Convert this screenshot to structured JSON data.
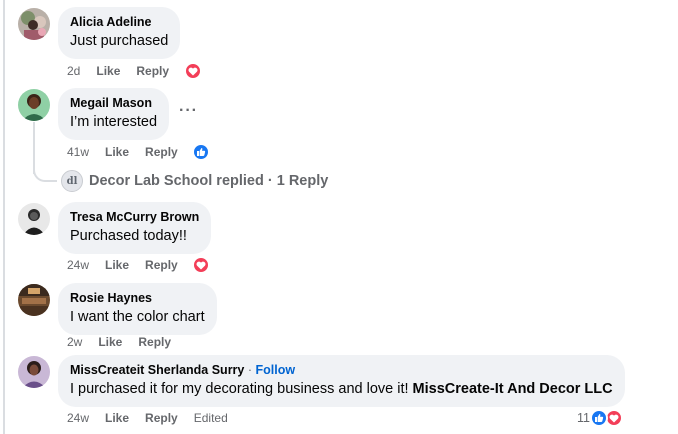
{
  "comments": [
    {
      "author": "Alicia Adeline",
      "text": "Just purchased",
      "time": "2d",
      "like": "Like",
      "reply": "Reply",
      "reaction": "heart"
    },
    {
      "author": "Megail Mason",
      "text": "I’m interested",
      "time": "41w",
      "like": "Like",
      "reply": "Reply",
      "reaction": "like",
      "more": "···",
      "replies_summary": {
        "author": "Decor Lab School",
        "label": "Decor Lab School replied · 1 Reply"
      }
    },
    {
      "author": "Tresa McCurry Brown",
      "text": "Purchased today!!",
      "time": "24w",
      "like": "Like",
      "reply": "Reply",
      "reaction": "heart"
    },
    {
      "author": "Rosie Haynes",
      "text": "I want the color chart",
      "time": "2w",
      "like": "Like",
      "reply": "Reply"
    },
    {
      "author": "MissCreateit Sherlanda Surry",
      "separator": "·",
      "follow": "Follow",
      "text": "I purchased it for my decorating business and love it!",
      "mention": "MissCreate-It And Decor LLC",
      "time": "24w",
      "like": "Like",
      "reply": "Reply",
      "edited": "Edited",
      "reaction_count": "11",
      "reactions": [
        "like",
        "heart"
      ]
    }
  ],
  "colors": {
    "bubble": "#f0f2f5",
    "meta": "#65676b",
    "follow": "#0064d1",
    "heart": "#f33e58",
    "like": "#1877f2"
  }
}
